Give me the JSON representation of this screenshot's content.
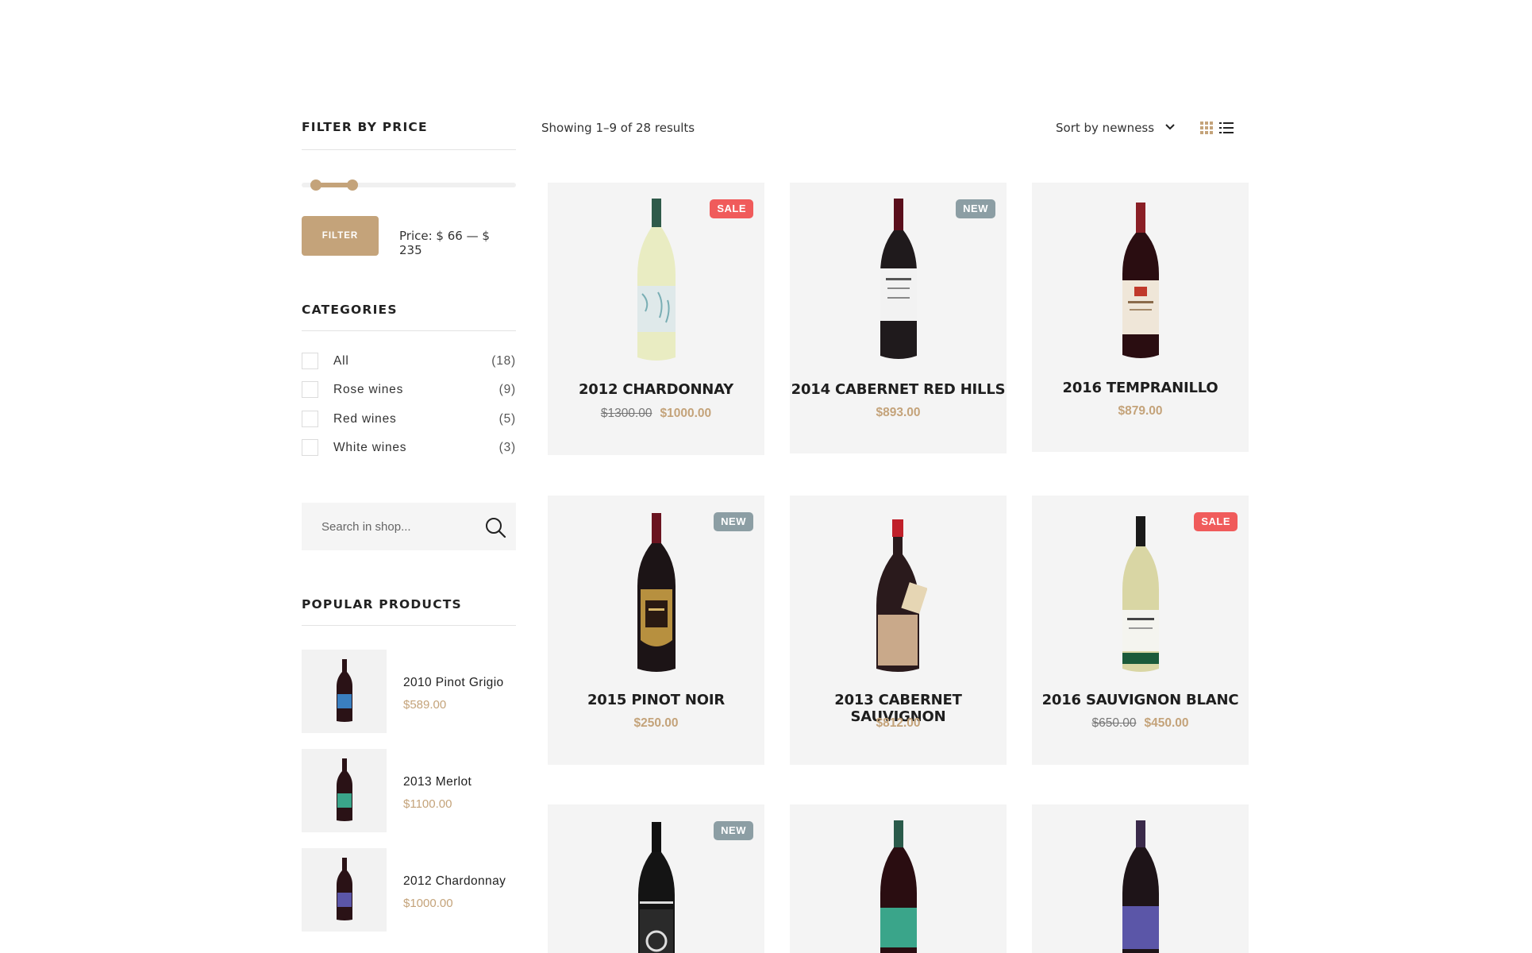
{
  "sidebar": {
    "price_filter": {
      "title": "FILTER BY PRICE",
      "button_label": "FILTER",
      "price_text": "Price: $ 66 — $ 235",
      "min": 66,
      "max": 235
    },
    "categories": {
      "title": "CATEGORIES",
      "items": [
        {
          "label": "All",
          "count": "(18)"
        },
        {
          "label": "Rose wines",
          "count": "(9)"
        },
        {
          "label": "Red wines",
          "count": "(5)"
        },
        {
          "label": "White wines",
          "count": "(3)"
        }
      ]
    },
    "search": {
      "placeholder": "Search in shop..."
    },
    "popular": {
      "title": "POPULAR PRODUCTS",
      "items": [
        {
          "name": "2010 Pinot Grigio",
          "price": "$589.00",
          "label_color": "#3a7fc0"
        },
        {
          "name": "2013 Merlot",
          "price": "$1100.00",
          "label_color": "#3aa58a"
        },
        {
          "name": "2012 Chardonnay",
          "price": "$1000.00",
          "label_color": "#5b56a8"
        }
      ]
    }
  },
  "toolbar": {
    "results_text": "Showing 1–9 of 28 results",
    "sort_label": "Sort by newness"
  },
  "colors": {
    "accent": "#c4a37a",
    "sale_badge": "#f05b5b",
    "new_badge": "#8c9ea4",
    "card_bg": "#f4f4f4"
  },
  "products": [
    {
      "title": "2012 CHARDONNAY",
      "old_price": "$1300.00",
      "price": "$1000.00",
      "badge": "SALE",
      "badge_type": "sale",
      "bottle": "white",
      "label_color": "#dfe9ea"
    },
    {
      "title": "2014 CABERNET RED HILLS",
      "old_price": "",
      "price": "$893.00",
      "badge": "NEW",
      "badge_type": "new",
      "bottle": "red",
      "label_color": "#f2f2f2"
    },
    {
      "title": "2016 TEMPRANILLO",
      "old_price": "",
      "price": "$879.00",
      "badge": "",
      "badge_type": "",
      "bottle": "red",
      "label_color": "#efe6d8"
    },
    {
      "title": "2015 PINOT NOIR",
      "old_price": "",
      "price": "$250.00",
      "badge": "NEW",
      "badge_type": "new",
      "bottle": "red",
      "label_color": "#b7903f"
    },
    {
      "title": "2013 CABERNET SAUVIGNON",
      "old_price": "",
      "price": "$812.00",
      "badge": "",
      "badge_type": "",
      "bottle": "red",
      "label_color": "#c9a98a"
    },
    {
      "title": "2016 SAUVIGNON BLANC",
      "old_price": "$650.00",
      "price": "$450.00",
      "badge": "SALE",
      "badge_type": "sale",
      "bottle": "white",
      "label_color": "#f4f4ef"
    },
    {
      "title": "",
      "old_price": "",
      "price": "",
      "badge": "NEW",
      "badge_type": "new",
      "bottle": "black",
      "label_color": "#2a2a2a"
    },
    {
      "title": "",
      "old_price": "",
      "price": "",
      "badge": "",
      "badge_type": "",
      "bottle": "red",
      "label_color": "#3aa58a"
    },
    {
      "title": "",
      "old_price": "",
      "price": "",
      "badge": "",
      "badge_type": "",
      "bottle": "red",
      "label_color": "#5b56a8"
    }
  ]
}
